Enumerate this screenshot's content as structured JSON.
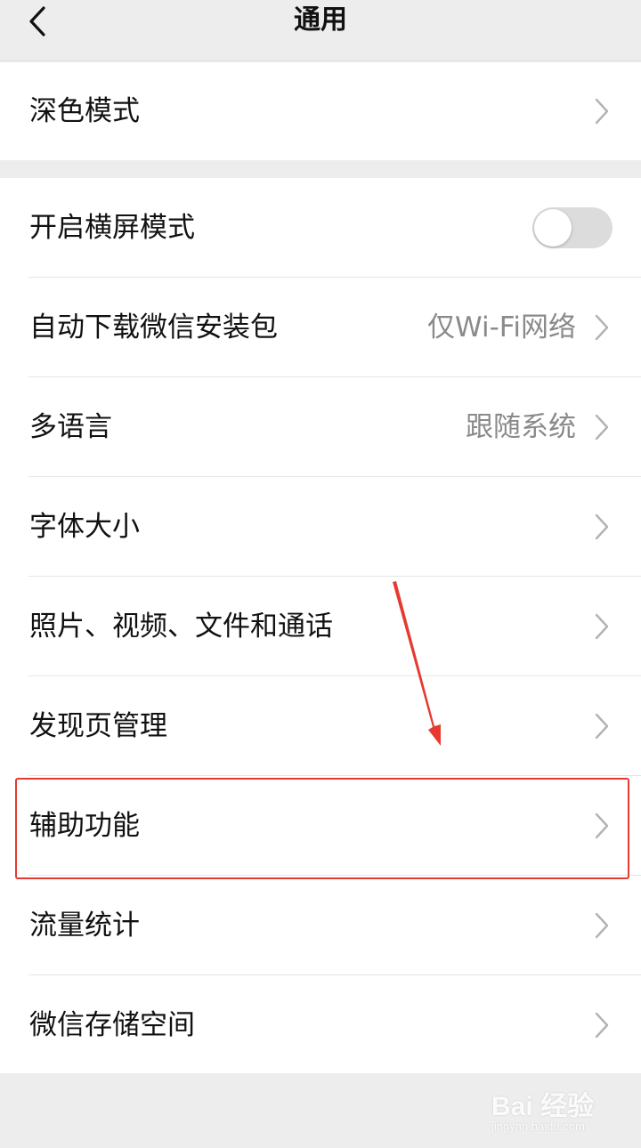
{
  "nav": {
    "title": "通用"
  },
  "groups": [
    {
      "items": [
        {
          "label": "深色模式"
        }
      ]
    },
    {
      "items": [
        {
          "label": "开启横屏模式",
          "toggle_on": false
        },
        {
          "label": "自动下载微信安装包",
          "value": "仅Wi-Fi网络"
        },
        {
          "label": "多语言",
          "value": "跟随系统"
        },
        {
          "label": "字体大小"
        },
        {
          "label": "照片、视频、文件和通话"
        },
        {
          "label": "发现页管理"
        },
        {
          "label": "辅助功能"
        },
        {
          "label": "流量统计"
        },
        {
          "label": "微信存储空间"
        }
      ]
    }
  ],
  "annotation": {
    "highlighted_item": "辅助功能",
    "color": "#e53a2f"
  },
  "watermark": {
    "main": "Bai 经验",
    "sub": "jingyan.baidu.com"
  },
  "colors": {
    "background": "#ededed",
    "card": "#ffffff",
    "secondary_text": "#8a8a8a",
    "toggle_off": "#dcdcdc"
  }
}
